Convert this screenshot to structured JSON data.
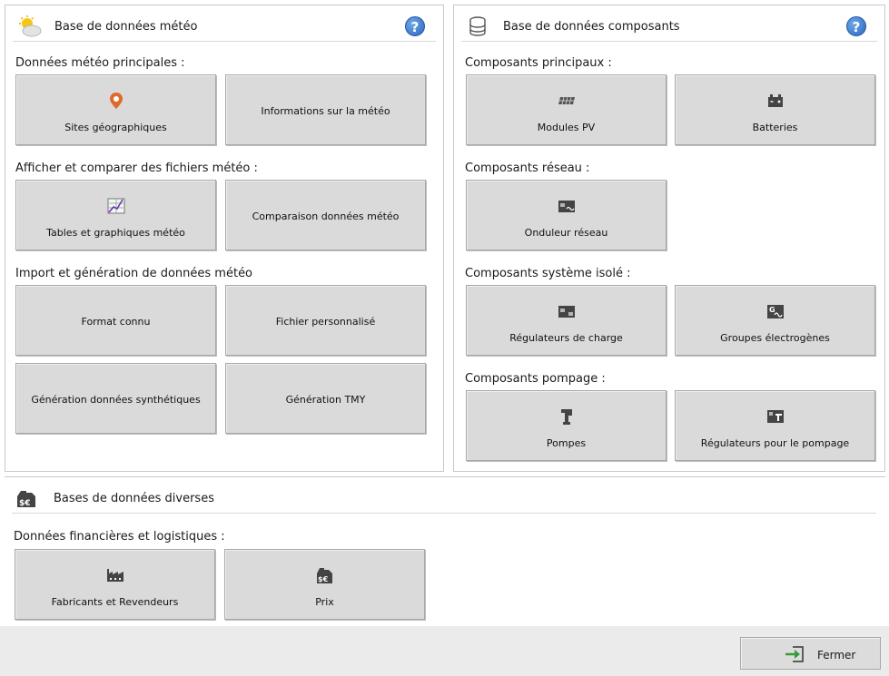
{
  "meteo": {
    "title": "Base de données météo",
    "help_label": "?",
    "section_main": "Données météo principales :",
    "section_display": "Afficher et comparer des fichiers météo :",
    "section_import": "Import et génération de données météo",
    "btn_sites": "Sites géographiques",
    "btn_info": "Informations sur la météo",
    "btn_tables": "Tables et graphiques météo",
    "btn_compare": "Comparaison données météo",
    "btn_format": "Format connu",
    "btn_custom": "Fichier personnalisé",
    "btn_synth": "Génération données synthétiques",
    "btn_tmy": "Génération TMY"
  },
  "components": {
    "title": "Base de données composants",
    "help_label": "?",
    "section_main": "Composants principaux :",
    "section_grid": "Composants réseau :",
    "section_standalone": "Composants système isolé :",
    "section_pumping": "Composants pompage :",
    "btn_pv": "Modules PV",
    "btn_batteries": "Batteries",
    "btn_inverter": "Onduleur réseau",
    "btn_regulators": "Régulateurs de charge",
    "btn_gensets": "Groupes électrogènes",
    "btn_pumps": "Pompes",
    "btn_pump_regulators": "Régulateurs pour le pompage"
  },
  "misc": {
    "title": "Bases de données diverses",
    "section_finance": "Données financières et logistiques :",
    "btn_manufacturers": "Fabricants et Revendeurs",
    "btn_prices": "Prix"
  },
  "footer": {
    "close_label": "Fermer"
  },
  "icons": {
    "meteo_header": "sun-cloud-icon",
    "components_header": "database-icon",
    "misc_header": "price-tag-icon",
    "sites": "map-pin-icon",
    "tables": "chart-table-icon",
    "pv": "solar-panel-icon",
    "batteries": "battery-icon",
    "inverter": "inverter-icon",
    "regulators": "charge-regulator-icon",
    "gensets": "generator-icon",
    "pumps": "pump-icon",
    "pump_regulators": "pump-regulator-icon",
    "manufacturers": "factory-icon",
    "prices": "price-tag-icon",
    "close": "exit-icon"
  },
  "colors": {
    "help_blue": "#2b67bf",
    "pin_orange": "#e06a2b",
    "exit_green": "#3a9a3a",
    "tile_bg": "#dadada"
  }
}
